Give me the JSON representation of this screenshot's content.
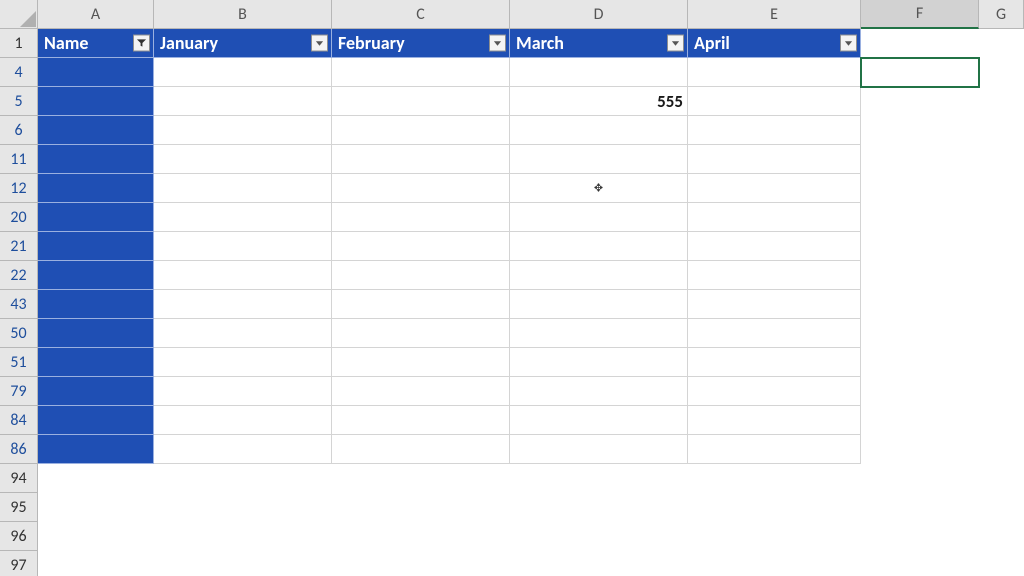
{
  "columns": [
    "A",
    "B",
    "C",
    "D",
    "E",
    "F",
    "G"
  ],
  "selected_column": "F",
  "selected_cell": "F4",
  "header_row_number": "1",
  "table_headers": {
    "A": "Name",
    "B": "January",
    "C": "February",
    "D": "March",
    "E": "April"
  },
  "filter_active_on": [
    "A"
  ],
  "visible_rows_filtered": [
    "4",
    "5",
    "6",
    "11",
    "12",
    "20",
    "21",
    "22",
    "43",
    "50",
    "51",
    "79",
    "84",
    "86"
  ],
  "visible_rows_plain": [
    "94",
    "95",
    "96",
    "97"
  ],
  "cell_values": {
    "D5": "555"
  },
  "cursor_at": "D12"
}
